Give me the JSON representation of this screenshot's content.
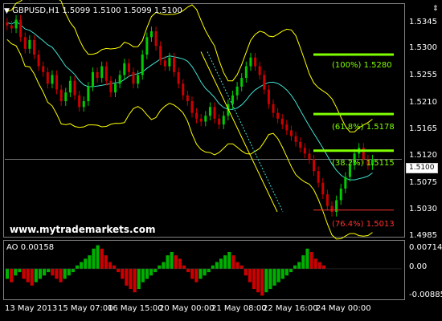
{
  "window": {
    "symbol_label": "GBPUSD,H1",
    "ohlc": "1.5099 1.5100 1.5099 1.5100",
    "arrow_icon": "sort-down-icon",
    "watermark": "www.mytrademarkets.com"
  },
  "main_axis": {
    "ticks": [
      "1.5345",
      "1.5300",
      "1.5255",
      "1.5210",
      "1.5165",
      "1.5120",
      "1.5075",
      "1.5030",
      "1.4985"
    ],
    "current_price": "1.5100"
  },
  "fibonacci": [
    {
      "label": "(100%) 1.5280",
      "color": "#7fff00"
    },
    {
      "label": "(61.8%) 1.5178",
      "color": "#7fff00"
    },
    {
      "label": "(38.2%) 1.5115",
      "color": "#7fff00"
    },
    {
      "label": "(76.4%) 1.5013",
      "color": "#ff3030"
    }
  ],
  "ao": {
    "label": "AO 0.00158",
    "ticks": [
      "0.00714",
      "0.00",
      "-0.00885"
    ]
  },
  "time_axis": {
    "labels": [
      "13 May 2013",
      "15 May 07:00",
      "16 May 15:00",
      "20 May 00:00",
      "21 May 08:00",
      "22 May 16:00",
      "24 May 00:00"
    ]
  },
  "colors": {
    "background": "#000000",
    "bull_candle": "#00cc00",
    "bear_candle": "#cc0000",
    "bollinger": "#ffff00",
    "moving_average": "#40e0d0",
    "fib_green": "#7fff00",
    "fib_red": "#ff3030",
    "ao_up": "#00b000",
    "ao_down": "#cc0000"
  },
  "chart_data": {
    "type": "candlestick",
    "symbol": "GBPUSD",
    "timeframe": "H1",
    "y_range": [
      1.497,
      1.536
    ],
    "price_series": [
      1.533,
      1.5325,
      1.534,
      1.531,
      1.529,
      1.5305,
      1.528,
      1.526,
      1.525,
      1.523,
      1.5245,
      1.522,
      1.52,
      1.5215,
      1.5235,
      1.521,
      1.519,
      1.52,
      1.5225,
      1.525,
      1.524,
      1.526,
      1.5235,
      1.5215,
      1.523,
      1.5245,
      1.5265,
      1.525,
      1.523,
      1.5245,
      1.528,
      1.531,
      1.532,
      1.5295,
      1.527,
      1.526,
      1.5275,
      1.525,
      1.523,
      1.521,
      1.52,
      1.518,
      1.517,
      1.5165,
      1.5175,
      1.519,
      1.517,
      1.516,
      1.5175,
      1.5195,
      1.521,
      1.5225,
      1.524,
      1.526,
      1.5275,
      1.526,
      1.5245,
      1.522,
      1.5195,
      1.518,
      1.517,
      1.516,
      1.515,
      1.514,
      1.513,
      1.512,
      1.511,
      1.51,
      1.508,
      1.506,
      1.504,
      1.502,
      1.501,
      1.503,
      1.505,
      1.507,
      1.509,
      1.511,
      1.512,
      1.51,
      1.509,
      1.51
    ],
    "ao_values": [
      -0.003,
      -0.004,
      -0.002,
      -0.001,
      -0.003,
      -0.004,
      -0.005,
      -0.004,
      -0.003,
      -0.002,
      -0.001,
      -0.002,
      -0.003,
      -0.004,
      -0.003,
      -0.002,
      -0.001,
      0.001,
      0.002,
      0.003,
      0.004,
      0.006,
      0.007,
      0.006,
      0.004,
      0.002,
      0.001,
      -0.001,
      -0.003,
      -0.005,
      -0.006,
      -0.007,
      -0.006,
      -0.004,
      -0.003,
      -0.002,
      -0.001,
      0.001,
      0.002,
      0.004,
      0.005,
      0.004,
      0.003,
      0.001,
      -0.001,
      -0.003,
      -0.004,
      -0.003,
      -0.002,
      -0.001,
      0.001,
      0.002,
      0.003,
      0.004,
      0.005,
      0.004,
      0.002,
      0.001,
      -0.002,
      -0.004,
      -0.006,
      -0.007,
      -0.008,
      -0.007,
      -0.006,
      -0.005,
      -0.004,
      -0.003,
      -0.002,
      -0.001,
      0.001,
      0.002,
      0.004,
      0.006,
      0.005,
      0.003,
      0.002,
      0.001
    ],
    "ao_range": [
      -0.00885,
      0.00714
    ]
  }
}
